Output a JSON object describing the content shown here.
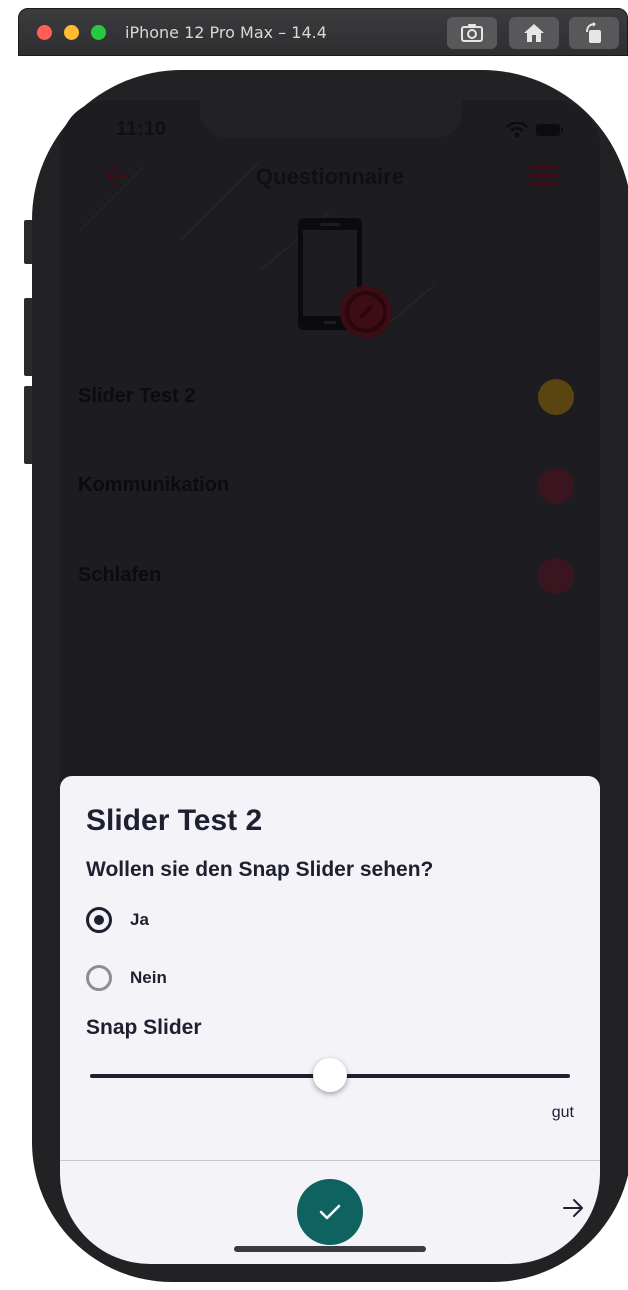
{
  "window": {
    "title": "iPhone 12 Pro Max – 14.4",
    "buttons": [
      "screenshot-icon",
      "home-icon",
      "rotate-icon"
    ]
  },
  "status_bar": {
    "time": "11:10"
  },
  "app": {
    "title": "Questionnaire",
    "items": [
      {
        "label": "Slider Test 2",
        "status_color": "#5a4410"
      },
      {
        "label": "Kommunikation",
        "status_color": "#3a1520"
      },
      {
        "label": "Schlafen",
        "status_color": "#3a1520"
      }
    ]
  },
  "sheet": {
    "title": "Slider Test 2",
    "question": "Wollen sie den Snap Slider sehen?",
    "options": [
      {
        "label": "Ja",
        "selected": true
      },
      {
        "label": "Nein",
        "selected": false
      }
    ],
    "slider": {
      "title": "Snap Slider",
      "value_fraction": 0.5,
      "value_label": "gut"
    }
  },
  "colors": {
    "accent": "#0e6360",
    "brand_red": "#8b1325",
    "text_dark": "#1e2030",
    "sheet_bg": "#f3f3f8"
  }
}
